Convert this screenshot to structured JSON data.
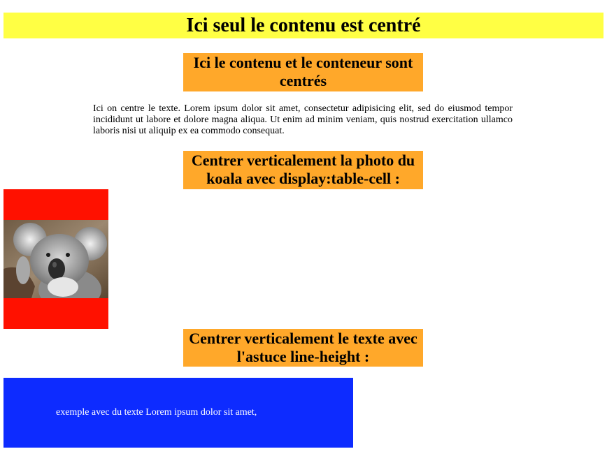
{
  "heading_main": "Ici seul le contenu est centré",
  "heading_centered": "Ici le contenu et le conteneur sont centrés",
  "paragraph": "Ici on centre le texte. Lorem ipsum dolor sit amet, consectetur adipisicing elit, sed do eiusmod tempor incididunt ut labore et dolore magna aliqua. Ut enim ad minim veniam, quis nostrud exercitation ullamco laboris nisi ut aliquip ex ea commodo consequat.",
  "heading_photo": "Centrer verticalement la photo du koala avec display:table-cell :",
  "heading_text": "Centrer verticalement le texte avec l'astuce line-height :",
  "blue_text": "exemple avec du texte Lorem ipsum dolor sit amet,",
  "colors": {
    "heading_bg": "#ffff44",
    "orange_bg": "#ffa82a",
    "photo_cell_bg": "#ff1100",
    "blue_bg": "#0d2bff"
  },
  "koala_image": "koala photo"
}
